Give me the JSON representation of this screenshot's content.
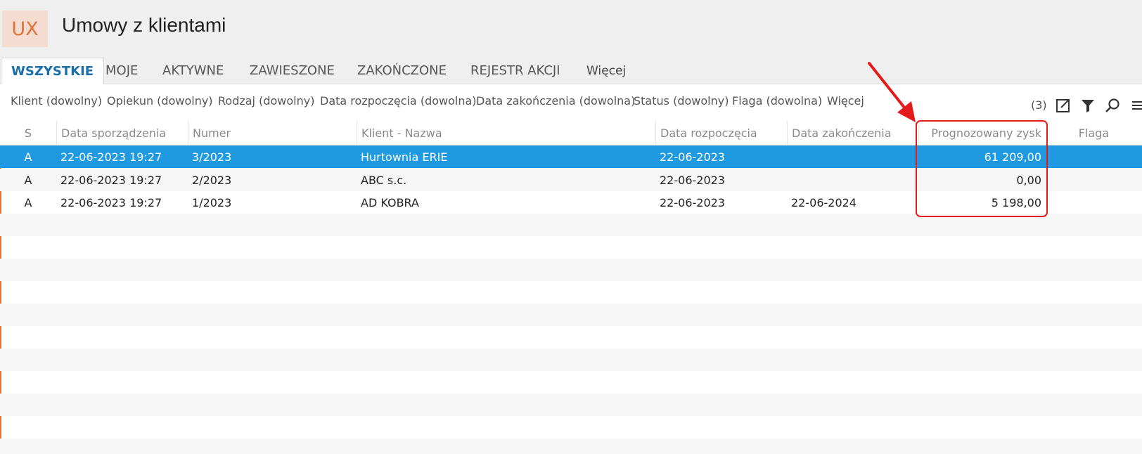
{
  "app": {
    "logo_text": "UX",
    "title": "Umowy z klientami"
  },
  "tabs": [
    {
      "label": "WSZYSTKIE",
      "active": true
    },
    {
      "label": "MOJE"
    },
    {
      "label": "AKTYWNE"
    },
    {
      "label": "ZAWIESZONE"
    },
    {
      "label": "ZAKOŃCZONE"
    },
    {
      "label": "REJESTR AKCJI"
    },
    {
      "label": "Więcej"
    }
  ],
  "filters": [
    "Klient (dowolny)",
    "Opiekun (dowolny)",
    "Rodzaj (dowolny)",
    "Data rozpoczęcia (dowolna)",
    "Data zakończenia (dowolna)",
    "Status (dowolny)",
    "Flaga (dowolna)",
    "Więcej"
  ],
  "toolbar": {
    "count": "(3)",
    "icons": [
      "expand-icon",
      "filter-icon",
      "search-icon",
      "menu-icon"
    ]
  },
  "table": {
    "columns": [
      "S",
      "Data sporządzenia",
      "Numer",
      "Klient - Nazwa",
      "Data rozpoczęcia",
      "Data zakończenia",
      "Prognozowany zysk",
      "Flaga"
    ],
    "rows": [
      {
        "s": "A",
        "date": "22-06-2023 19:27",
        "number": "3/2023",
        "client": "Hurtownia ERIE",
        "start": "22-06-2023",
        "end": "",
        "profit": "61 209,00",
        "flag": "",
        "selected": true
      },
      {
        "s": "A",
        "date": "22-06-2023 19:27",
        "number": "2/2023",
        "client": "ABC s.c.",
        "start": "22-06-2023",
        "end": "",
        "profit": "0,00",
        "flag": ""
      },
      {
        "s": "A",
        "date": "22-06-2023 19:27",
        "number": "1/2023",
        "client": "AD KOBRA",
        "start": "22-06-2023",
        "end": "22-06-2024",
        "profit": "5 198,00",
        "flag": ""
      }
    ]
  },
  "colors": {
    "accent": "#e0723a",
    "selection": "#1f9ae0",
    "active_tab": "#1a6ea8",
    "annotation": "#e41b1b"
  }
}
